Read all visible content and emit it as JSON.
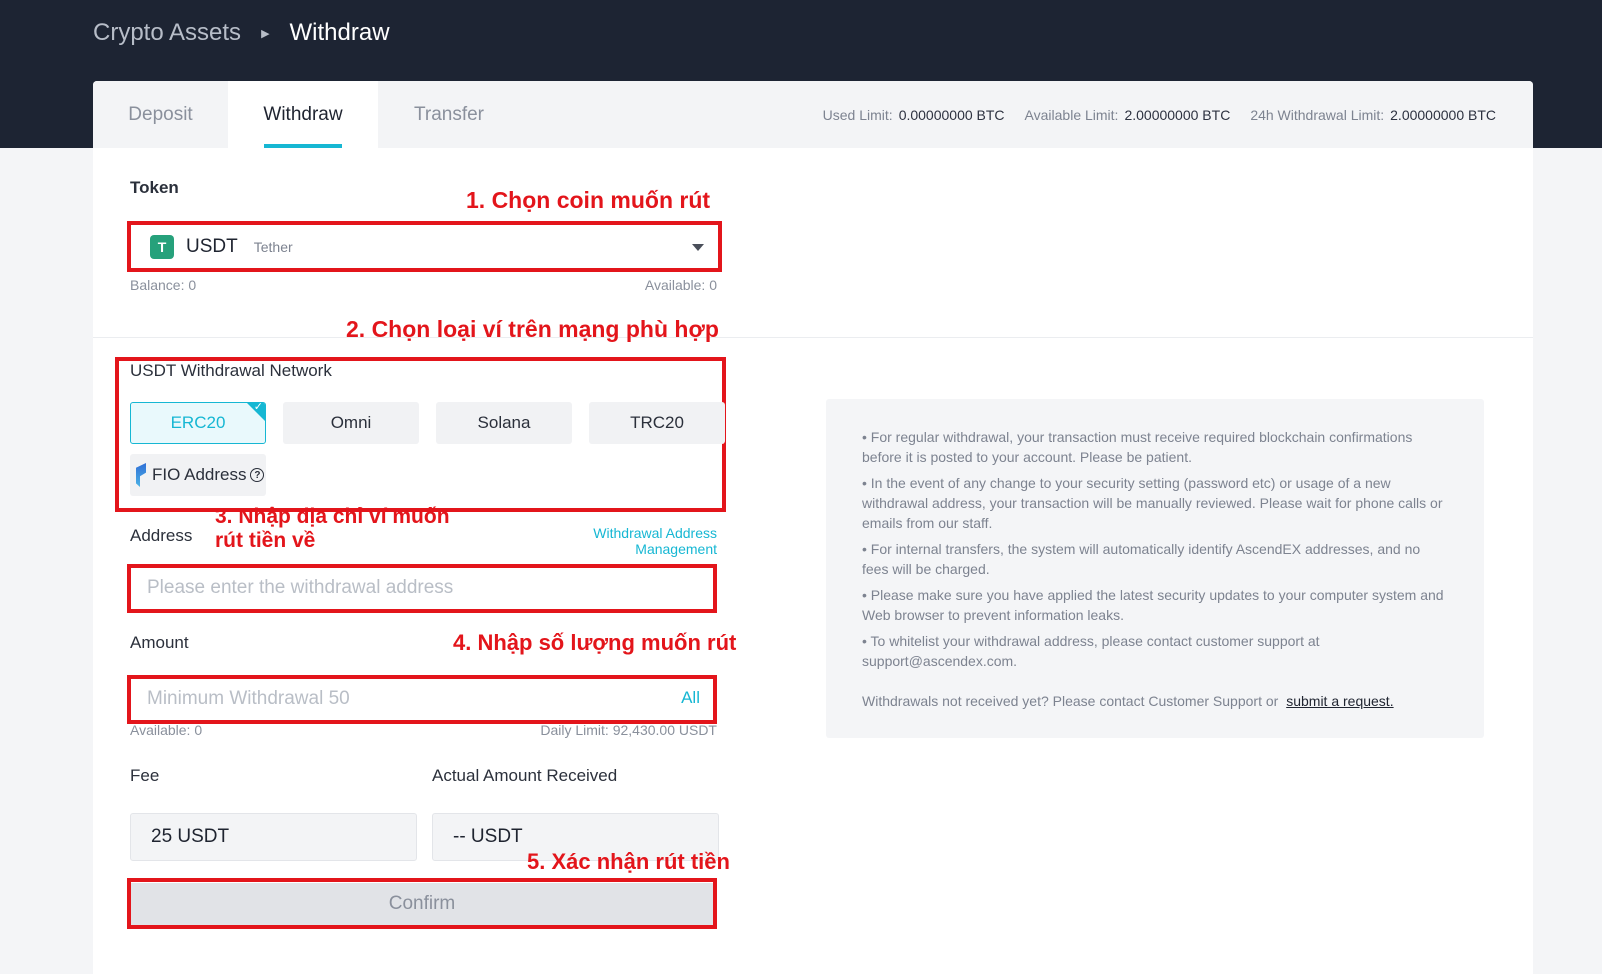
{
  "breadcrumb": {
    "parent": "Crypto Assets",
    "current": "Withdraw"
  },
  "tabs": [
    "Deposit",
    "Withdraw",
    "Transfer"
  ],
  "limits": [
    {
      "label": "Used Limit:",
      "value": "0.00000000 BTC"
    },
    {
      "label": "Available Limit:",
      "value": "2.00000000 BTC"
    },
    {
      "label": "24h Withdrawal Limit:",
      "value": "2.00000000 BTC"
    }
  ],
  "token": {
    "label": "Token",
    "symbol": "USDT",
    "name": "Tether",
    "logo_letter": "T",
    "balance": "Balance: 0",
    "available": "Available: 0"
  },
  "network": {
    "label": "USDT Withdrawal Network",
    "options": [
      "ERC20",
      "Omni",
      "Solana",
      "TRC20"
    ],
    "selected": "ERC20",
    "fio_label": "FIO Address"
  },
  "address": {
    "label": "Address",
    "manage_link": "Withdrawal Address Management",
    "placeholder": "Please enter the withdrawal address"
  },
  "amount": {
    "label": "Amount",
    "placeholder": "Minimum Withdrawal 50",
    "all_label": "All",
    "available": "Available: 0",
    "daily_limit": "Daily Limit: 92,430.00 USDT"
  },
  "fee": {
    "label": "Fee",
    "value": "25 USDT"
  },
  "received": {
    "label": "Actual Amount Received",
    "value": "-- USDT"
  },
  "confirm_label": "Confirm",
  "annotations": {
    "step1": "1. Chọn coin muốn rút",
    "step2": "2. Chọn loại ví trên mạng phù hợp",
    "step3_line1": "3. Nhập địa chỉ ví muốn",
    "step3_line2": "rút tiền về",
    "step4": "4. Nhập số lượng muốn rút",
    "step5": "5. Xác nhận rút tiền"
  },
  "notices": [
    "• For regular withdrawal, your transaction must receive required blockchain confirmations before it is posted to your account. Please be patient.",
    "• In the event of any change to your security setting (password etc) or usage of a new withdrawal address, your transaction will be manually reviewed. Please wait for phone calls or emails from our staff.",
    "• For internal transfers, the system will automatically identify AscendEX addresses, and no fees will be charged.",
    "• Please make sure you have applied the latest security updates to your computer system and Web browser to prevent information leaks.",
    "• To whitelist your withdrawal address, please contact customer support at support@ascendex.com."
  ],
  "notice_footer": "Withdrawals not received yet? Please contact Customer Support or",
  "notice_link": "submit a request.",
  "colors": {
    "accent": "#16b7d3",
    "annotation": "#e3151b",
    "header_bg": "#1d2433"
  }
}
